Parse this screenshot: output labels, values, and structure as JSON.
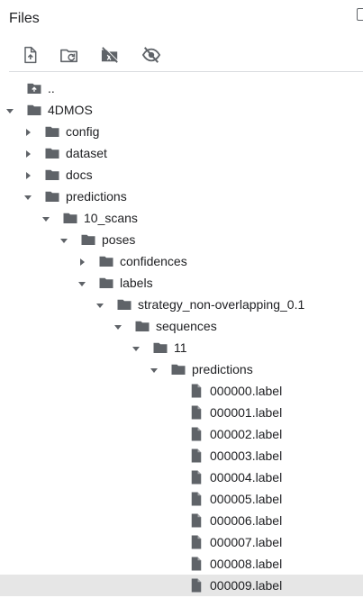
{
  "panel": {
    "title": "Files"
  },
  "toolbar": {
    "buttons": [
      {
        "name": "upload-file",
        "icon": "upload-file-icon"
      },
      {
        "name": "refresh-folder",
        "icon": "folder-refresh-icon"
      },
      {
        "name": "mount-drive",
        "icon": "drive-off-icon"
      },
      {
        "name": "toggle-hidden",
        "icon": "eye-off-icon"
      }
    ]
  },
  "tree": [
    {
      "label": "..",
      "type": "parent",
      "depth": 0,
      "caret": "none"
    },
    {
      "label": "4DMOS",
      "type": "folder",
      "depth": 0,
      "caret": "open"
    },
    {
      "label": "config",
      "type": "folder",
      "depth": 1,
      "caret": "closed"
    },
    {
      "label": "dataset",
      "type": "folder",
      "depth": 1,
      "caret": "closed"
    },
    {
      "label": "docs",
      "type": "folder",
      "depth": 1,
      "caret": "closed"
    },
    {
      "label": "predictions",
      "type": "folder",
      "depth": 1,
      "caret": "open"
    },
    {
      "label": "10_scans",
      "type": "folder",
      "depth": 2,
      "caret": "open"
    },
    {
      "label": "poses",
      "type": "folder",
      "depth": 3,
      "caret": "open"
    },
    {
      "label": "confidences",
      "type": "folder",
      "depth": 4,
      "caret": "closed"
    },
    {
      "label": "labels",
      "type": "folder",
      "depth": 4,
      "caret": "open"
    },
    {
      "label": "strategy_non-overlapping_0.1",
      "type": "folder",
      "depth": 5,
      "caret": "open"
    },
    {
      "label": "sequences",
      "type": "folder",
      "depth": 6,
      "caret": "open"
    },
    {
      "label": "11",
      "type": "folder",
      "depth": 7,
      "caret": "open"
    },
    {
      "label": "predictions",
      "type": "folder",
      "depth": 8,
      "caret": "open"
    },
    {
      "label": "000000.label",
      "type": "file",
      "depth": 9,
      "caret": "none"
    },
    {
      "label": "000001.label",
      "type": "file",
      "depth": 9,
      "caret": "none"
    },
    {
      "label": "000002.label",
      "type": "file",
      "depth": 9,
      "caret": "none"
    },
    {
      "label": "000003.label",
      "type": "file",
      "depth": 9,
      "caret": "none"
    },
    {
      "label": "000004.label",
      "type": "file",
      "depth": 9,
      "caret": "none"
    },
    {
      "label": "000005.label",
      "type": "file",
      "depth": 9,
      "caret": "none"
    },
    {
      "label": "000006.label",
      "type": "file",
      "depth": 9,
      "caret": "none"
    },
    {
      "label": "000007.label",
      "type": "file",
      "depth": 9,
      "caret": "none"
    },
    {
      "label": "000008.label",
      "type": "file",
      "depth": 9,
      "caret": "none"
    },
    {
      "label": "000009.label",
      "type": "file",
      "depth": 9,
      "caret": "none",
      "selected": true
    }
  ],
  "colors": {
    "icon": "#5f6368",
    "selected_row": "#e6e6e6",
    "divider": "#dadce0"
  }
}
